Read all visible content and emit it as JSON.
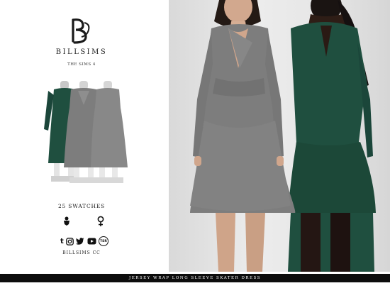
{
  "brand": {
    "name": "BILLSIMS",
    "game": "THE SIMS 4",
    "logo_icon": "bs-monogram-icon"
  },
  "swatches": "25 SWATCHES",
  "gender_icons": [
    "male-mannequin-icon",
    "female-symbol-icon"
  ],
  "social_icons": [
    "tumblr-icon",
    "instagram-icon",
    "twitter-icon",
    "youtube-icon",
    "tsr-icon"
  ],
  "tsr_label": "TSR",
  "cc_label": "BILLSIMS  CC",
  "footer": {
    "title": "JERSEY WRAP LONG SLEEVE SKATER DRESS"
  },
  "colors": {
    "footer_bg": "#0d0d0d",
    "dress_gray": "#7a7a7a",
    "dress_green": "#1f4f3f",
    "background": "#ffffff"
  }
}
